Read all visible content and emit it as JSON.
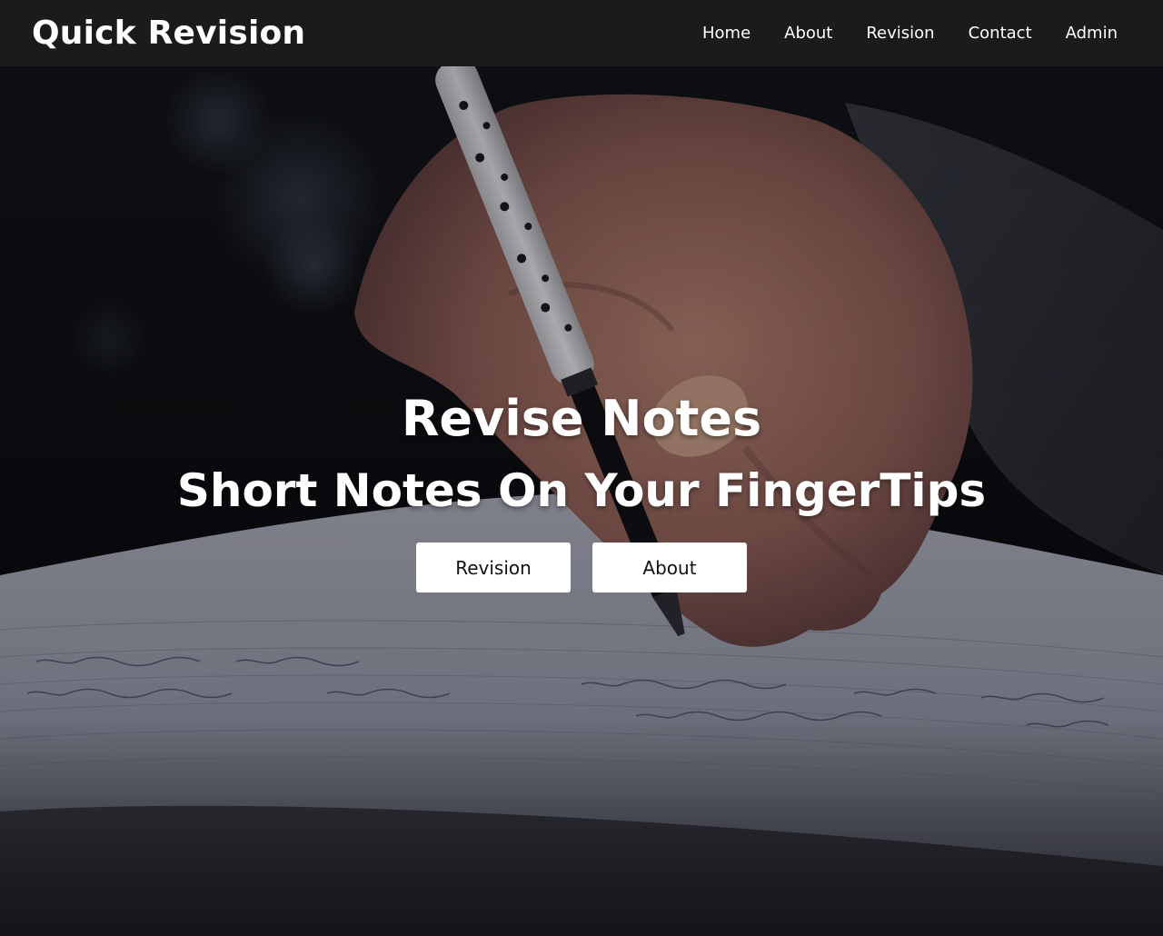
{
  "nav": {
    "brand": "Quick Revision",
    "links": [
      {
        "label": "Home"
      },
      {
        "label": "About"
      },
      {
        "label": "Revision"
      },
      {
        "label": "Contact"
      },
      {
        "label": "Admin"
      }
    ]
  },
  "hero": {
    "background_image": "hand-writing-notes-with-pen",
    "title": "Revise Notes",
    "subtitle": "Short Notes On Your FingerTips",
    "buttons": [
      {
        "label": "Revision"
      },
      {
        "label": "About"
      }
    ]
  },
  "colors": {
    "navbar_bg": "#1b1b1b",
    "button_bg": "#ffffff",
    "text_light": "#ffffff"
  }
}
